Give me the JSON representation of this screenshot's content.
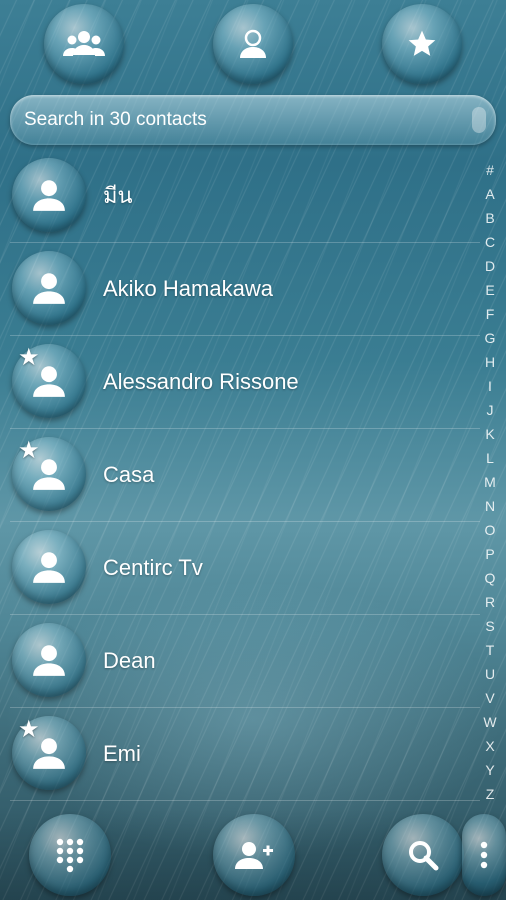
{
  "search": {
    "placeholder": "Search in 30 contacts"
  },
  "contacts": [
    {
      "name": "มีน",
      "favorite": false
    },
    {
      "name": "Akiko Hamakawa",
      "favorite": false
    },
    {
      "name": "Alessandro Rissone",
      "favorite": true
    },
    {
      "name": "Casa",
      "favorite": true
    },
    {
      "name": "Centirc Tv",
      "favorite": false
    },
    {
      "name": "Dean",
      "favorite": false
    },
    {
      "name": "Emi",
      "favorite": true
    }
  ],
  "alphabet": [
    "#",
    "A",
    "B",
    "C",
    "D",
    "E",
    "F",
    "G",
    "H",
    "I",
    "J",
    "K",
    "L",
    "M",
    "N",
    "O",
    "P",
    "Q",
    "R",
    "S",
    "T",
    "U",
    "V",
    "W",
    "X",
    "Y",
    "Z"
  ],
  "top_bar": {
    "icons": [
      "groups-icon",
      "contact-icon",
      "star-icon"
    ]
  },
  "bottom_bar": {
    "icons": [
      "dialpad-icon",
      "add-contact-icon",
      "search-icon",
      "more-icon"
    ]
  }
}
